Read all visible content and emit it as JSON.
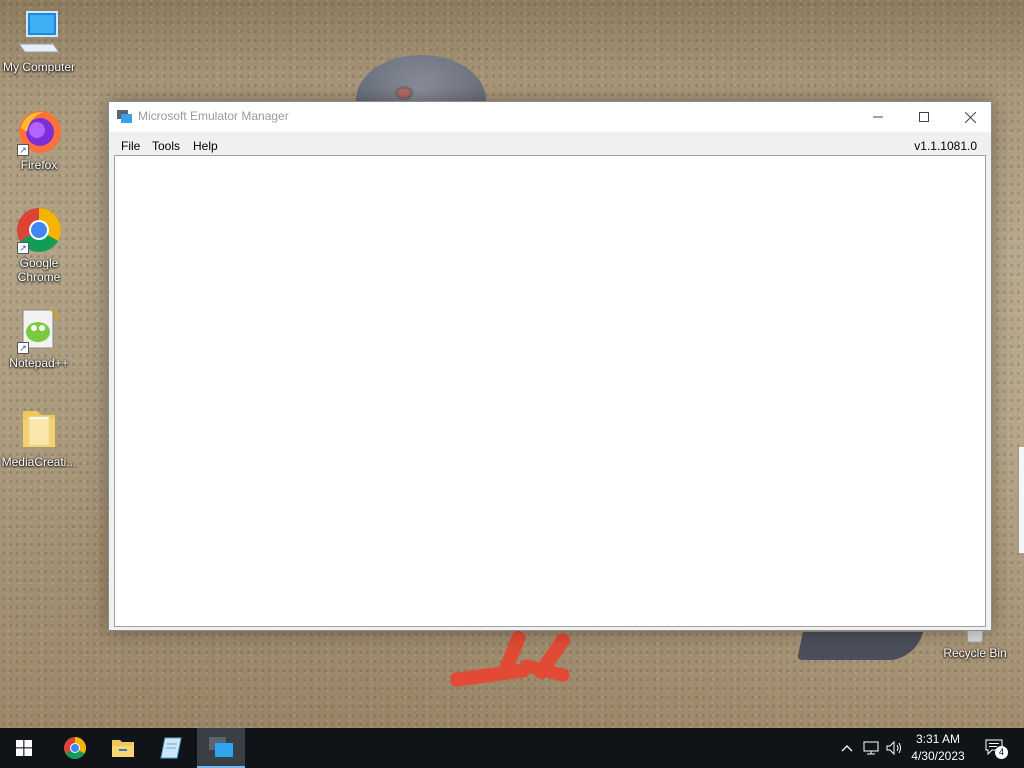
{
  "desktop": {
    "icons": [
      {
        "label": "My Computer"
      },
      {
        "label": "Firefox"
      },
      {
        "label": "Google\nChrome"
      },
      {
        "label": "Notepad++"
      },
      {
        "label": "MediaCreati..."
      },
      {
        "label": "Recycle Bin"
      }
    ]
  },
  "window": {
    "title": "Microsoft Emulator Manager",
    "menu": [
      "File",
      "Tools",
      "Help"
    ],
    "version": "v1.1.1081.0"
  },
  "taskbar": {
    "clock_time": "3:31 AM",
    "clock_date": "4/30/2023",
    "notification_count": "4"
  },
  "colors": {
    "accent": "#76b9ed",
    "taskbar": "#101418"
  },
  "icons": [
    "windows-start-icon",
    "chrome-icon",
    "file-explorer-icon",
    "notepad-icon",
    "emulator-manager-icon",
    "chevron-up-icon",
    "network-icon",
    "volume-icon",
    "notification-icon"
  ]
}
